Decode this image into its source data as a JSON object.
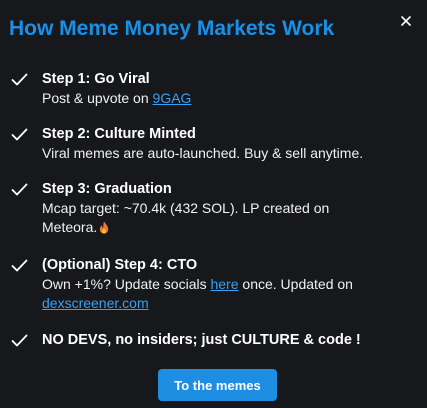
{
  "modal": {
    "title": "How Meme Money Markets Work",
    "close_icon": "close-icon",
    "accent_color": "#1a8fe6",
    "background_color": "#17181c"
  },
  "steps": [
    {
      "title": "Step 1: Go Viral",
      "desc_before": "Post & upvote on ",
      "link_text": "9GAG"
    },
    {
      "title": "Step 2: Culture Minted",
      "desc": "Viral memes are auto-launched. Buy & sell anytime."
    },
    {
      "title": "Step 3: Graduation",
      "desc_line1": "Mcap target: ~70.4k (432 SOL). LP created on",
      "desc_line2": "Meteora.",
      "icon": "fire-emoji-icon"
    },
    {
      "title": "(Optional) Step 4: CTO",
      "desc_before": "Own +1%? Update socials ",
      "link_text": "here",
      "desc_after": " once. Updated on",
      "link2_text": "dexscreener.com"
    },
    {
      "title": "NO DEVS, no insiders; just CULTURE & code !"
    }
  ],
  "cta": {
    "label": "To the memes"
  }
}
